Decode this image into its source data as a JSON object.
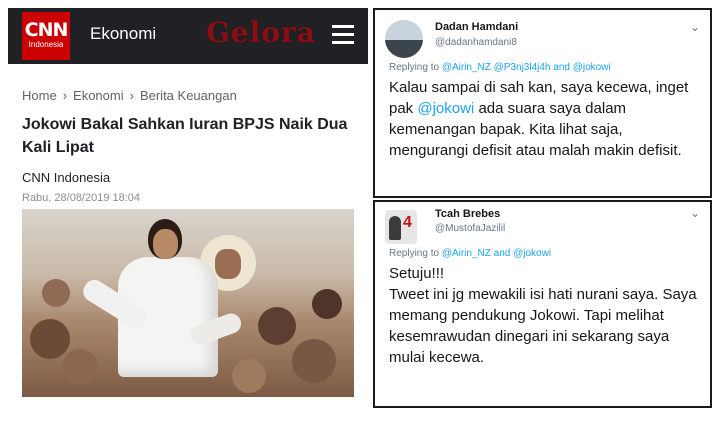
{
  "article": {
    "logo": {
      "main": "CNN",
      "sub": "Indonesia"
    },
    "section": "Ekonomi",
    "watermark": "Gelora",
    "breadcrumb": [
      "Home",
      "Ekonomi",
      "Berita Keuangan"
    ],
    "breadcrumb_separator": "›",
    "headline": "Jokowi Bakal Sahkan Iuran BPJS Naik Dua Kali Lipat",
    "source": "CNN Indonesia",
    "date": "Rabu, 28/08/2019 18:04"
  },
  "tweets": [
    {
      "display_name": "Dadan Hamdani",
      "handle": "@dadanhamdani8",
      "replying_prefix": "Replying to",
      "replying_mentions": "@Airin_NZ @P3nj3l4j4h and @jokowi",
      "text_before": "Kalau sampai di sah kan, saya kecewa, inget pak ",
      "text_mention": "@jokowi",
      "text_after": " ada suara saya dalam kemenangan bapak. Kita lihat saja, mengurangi defisit atau malah makin defisit."
    },
    {
      "display_name": "Tcah Brebes",
      "handle": "@MustofaJazilil",
      "replying_prefix": "Replying to",
      "replying_mentions": "@Airin_NZ and @jokowi",
      "text": "Setuju!!!\nTweet ini jg mewakili isi hati nurani saya. Saya memang pendukung Jokowi. Tapi melihat kesemrawudan dinegari ini sekarang saya mulai kecewa."
    }
  ],
  "icons": {
    "menu": "hamburger-menu-icon",
    "chevron": "chevron-down-icon",
    "chevron_glyph": "⌄"
  },
  "colors": {
    "cnn_red": "#cc0000",
    "header_bg": "#202124",
    "twitter_blue": "#1da1f2",
    "watermark": "#8a0f14"
  }
}
